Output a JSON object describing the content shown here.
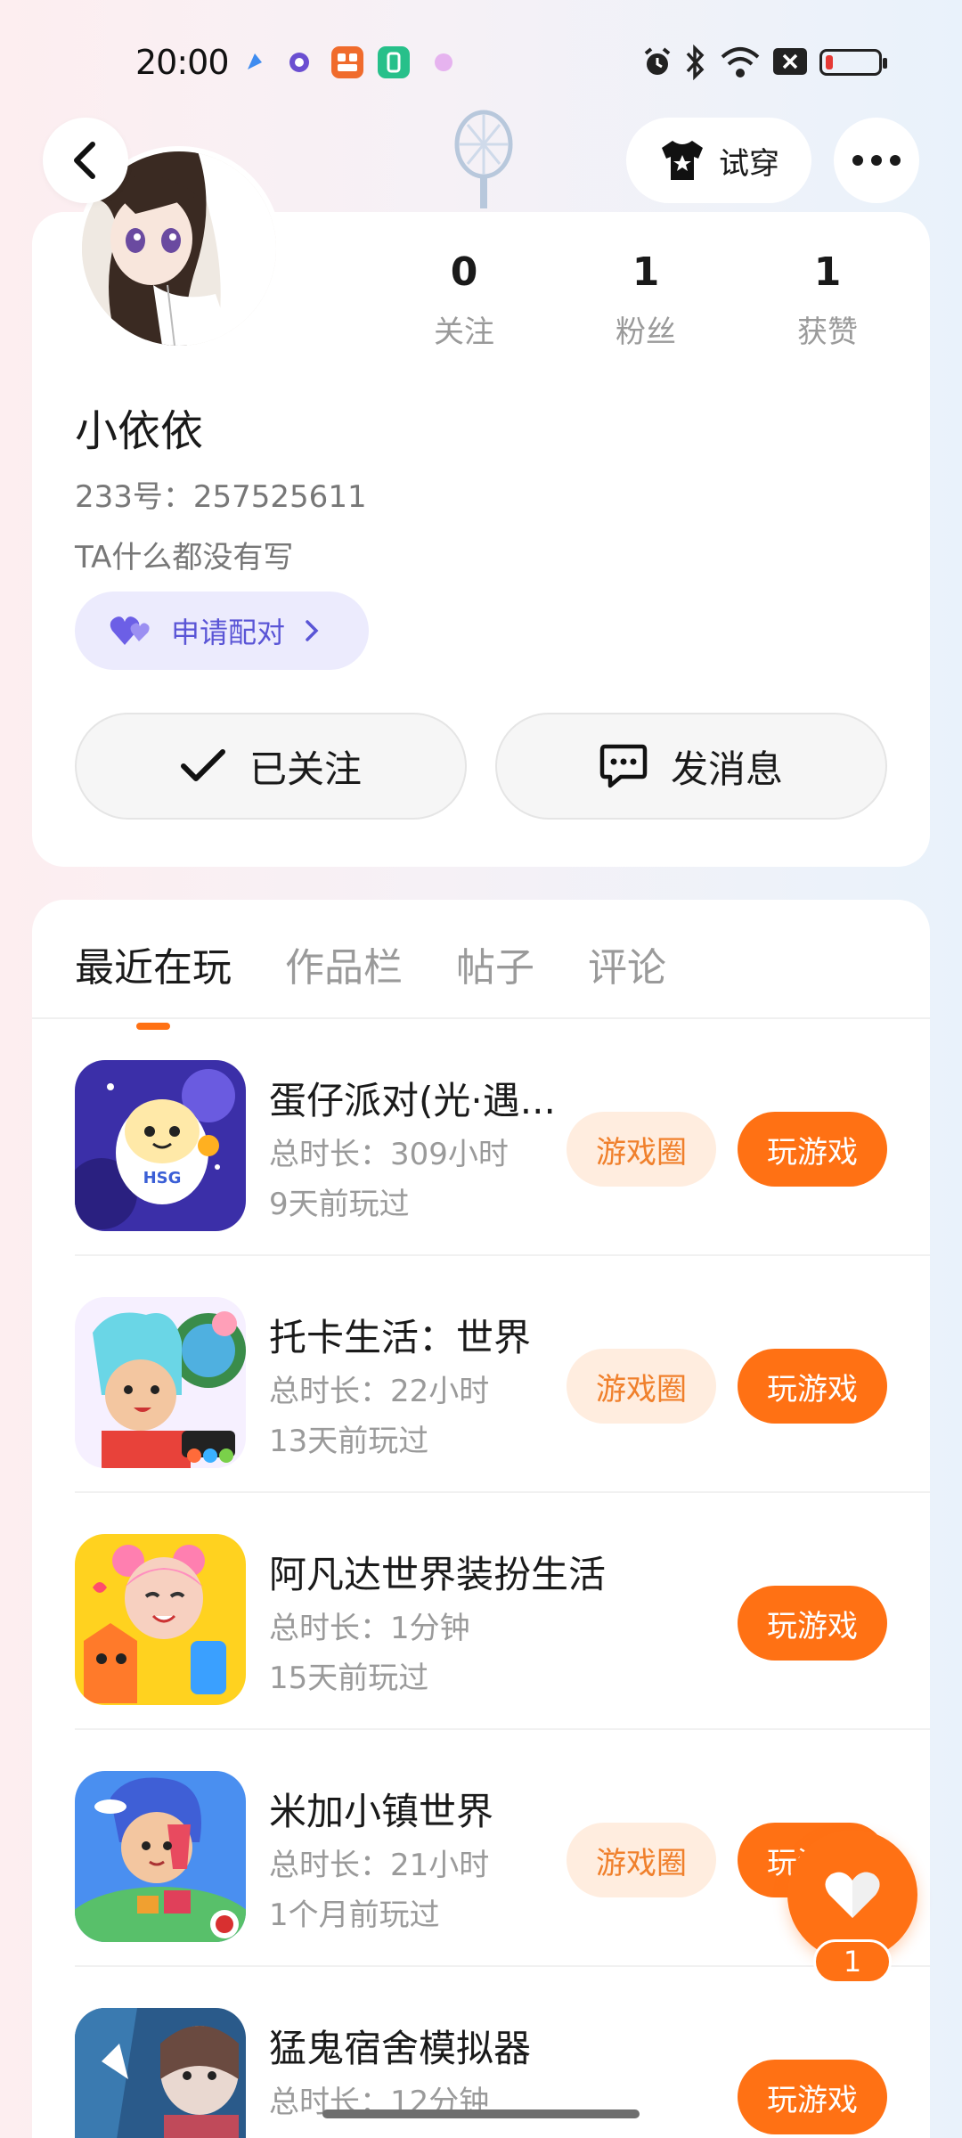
{
  "status_bar": {
    "time": "20:00"
  },
  "header": {
    "tryon_label": "试穿"
  },
  "profile": {
    "name": "小依依",
    "uid_label": "233号：257525611",
    "bio": "TA什么都没有写",
    "pair_label": "申请配对",
    "stats": [
      {
        "num": "0",
        "label": "关注"
      },
      {
        "num": "1",
        "label": "粉丝"
      },
      {
        "num": "1",
        "label": "获赞"
      }
    ],
    "followed_label": "已关注",
    "message_label": "发消息"
  },
  "tabs": [
    "最近在玩",
    "作品栏",
    "帖子",
    "评论"
  ],
  "games": [
    {
      "title": "蛋仔派对(光·遇...",
      "duration": "总时长：309小时",
      "last_played": "9天前玩过",
      "circle_label": "游戏圈",
      "play_label": "玩游戏"
    },
    {
      "title": "托卡生活：世界",
      "duration": "总时长：22小时",
      "last_played": "13天前玩过",
      "circle_label": "游戏圈",
      "play_label": "玩游戏"
    },
    {
      "title": "阿凡达世界装扮生活",
      "duration": "总时长：1分钟",
      "last_played": "15天前玩过",
      "play_label": "玩游戏"
    },
    {
      "title": "米加小镇世界",
      "duration": "总时长：21小时",
      "last_played": "1个月前玩过",
      "circle_label": "游戏圈",
      "play_label": "玩游戏"
    },
    {
      "title": "猛鬼宿舍模拟器",
      "duration": "总时长：12分钟",
      "last_played": "",
      "play_label": "玩游戏"
    }
  ],
  "like_float": {
    "count": "1"
  },
  "colors": {
    "accent": "#ff7114",
    "accent_light": "#ffeddf",
    "pair_bg": "#ecebfd",
    "pair_text": "#5a55d6"
  }
}
